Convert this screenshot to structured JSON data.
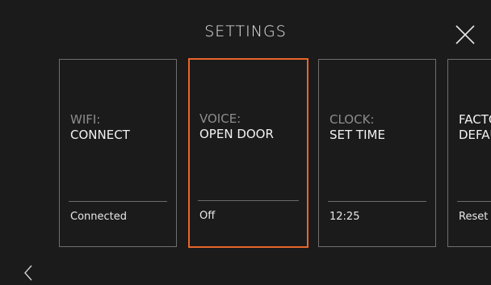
{
  "header": {
    "title": "SETTINGS"
  },
  "icons": {
    "close": "close-icon",
    "back": "chevron-left-icon"
  },
  "colors": {
    "background": "#1b1b1b",
    "accent": "#e8652a",
    "card_border": "#6f6f6f"
  },
  "cards": [
    {
      "category": "WIFI:",
      "name": "CONNECT",
      "status": "Connected",
      "selected": false
    },
    {
      "category": "VOICE:",
      "name": "OPEN DOOR",
      "status": "Off",
      "selected": true
    },
    {
      "category": "CLOCK:",
      "name": "SET TIME",
      "status": "12:25",
      "selected": false
    },
    {
      "category": "FACTORY",
      "name": "DEFAULTS",
      "status": "Reset",
      "selected": false
    }
  ]
}
